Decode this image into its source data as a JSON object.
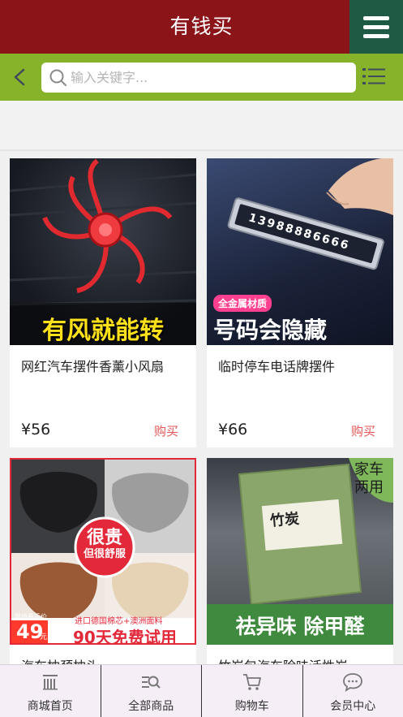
{
  "header": {
    "title": "有钱买"
  },
  "search": {
    "placeholder": "输入关键字..."
  },
  "products": [
    {
      "name": "网红汽车摆件香薰小风扇",
      "price": "¥56",
      "buy_label": "购买",
      "image_caption": "有风就能转"
    },
    {
      "name": "临时停车电话牌摆件",
      "price": "¥66",
      "buy_label": "购买",
      "image_caption": "号码会隐藏",
      "image_badge": "全金属材质",
      "image_number": "13988886666"
    },
    {
      "name": "汽车枕颈枕头",
      "image_circle_line1": "很贵",
      "image_circle_line2": "但很舒服",
      "image_bottom_text": "90天免费试用",
      "image_small_text": "进口德国棉芯+澳洲面料",
      "image_price_tag": "49",
      "image_price_small": "限值券手价",
      "image_price_unit": "元"
    },
    {
      "name": "竹炭包汽车除味活性炭",
      "image_corner": "家车两用",
      "image_bag_label": "竹炭",
      "image_caption": "祛异味 除甲醛"
    }
  ],
  "tabbar": [
    {
      "label": "商城首页",
      "icon": "store-icon"
    },
    {
      "label": "全部商品",
      "icon": "list-search-icon"
    },
    {
      "label": "购物车",
      "icon": "cart-icon"
    },
    {
      "label": "会员中心",
      "icon": "chat-bubble-icon"
    }
  ]
}
